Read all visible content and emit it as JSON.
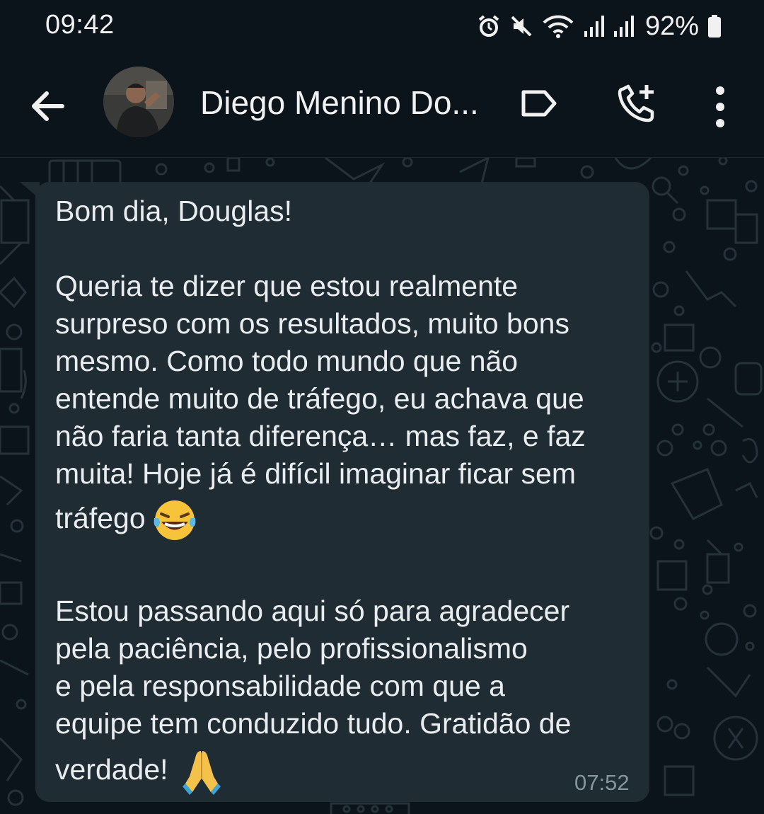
{
  "status_bar": {
    "time": "09:42",
    "battery": "92%",
    "icons": [
      "alarm-icon",
      "mute-icon",
      "wifi-icon",
      "signal-icon",
      "signal-icon",
      "battery-icon"
    ]
  },
  "header": {
    "contact_name": "Diego Menino Do...",
    "icons": [
      "back-arrow-icon",
      "label-icon",
      "add-call-icon",
      "more-vert-icon"
    ]
  },
  "message": {
    "paragraph_1": "Bom dia, Douglas!",
    "paragraph_2_lines": [
      "Queria te dizer que estou realmente",
      "surpreso com os resultados, muito bons",
      "mesmo. Como todo mundo que não",
      "entende muito de tráfego, eu achava que",
      "não faria tanta diferença… mas faz, e faz",
      "muita! Hoje já é difícil imaginar ficar sem"
    ],
    "paragraph_2_last": "tráfego",
    "paragraph_2_emoji": "laughing-tears-emoji",
    "paragraph_3_lines": [
      "Estou passando aqui só para agradecer",
      "pela paciência, pelo profissionalismo",
      "e pela responsabilidade com que a",
      "equipe tem conduzido tudo. Gratidão de"
    ],
    "paragraph_3_last": "verdade!",
    "paragraph_3_emoji": "folded-hands-emoji",
    "time": "07:52"
  },
  "colors": {
    "background": "#0b141a",
    "bubble": "#202c33",
    "text": "#e9edef",
    "meta": "#8696a0"
  }
}
